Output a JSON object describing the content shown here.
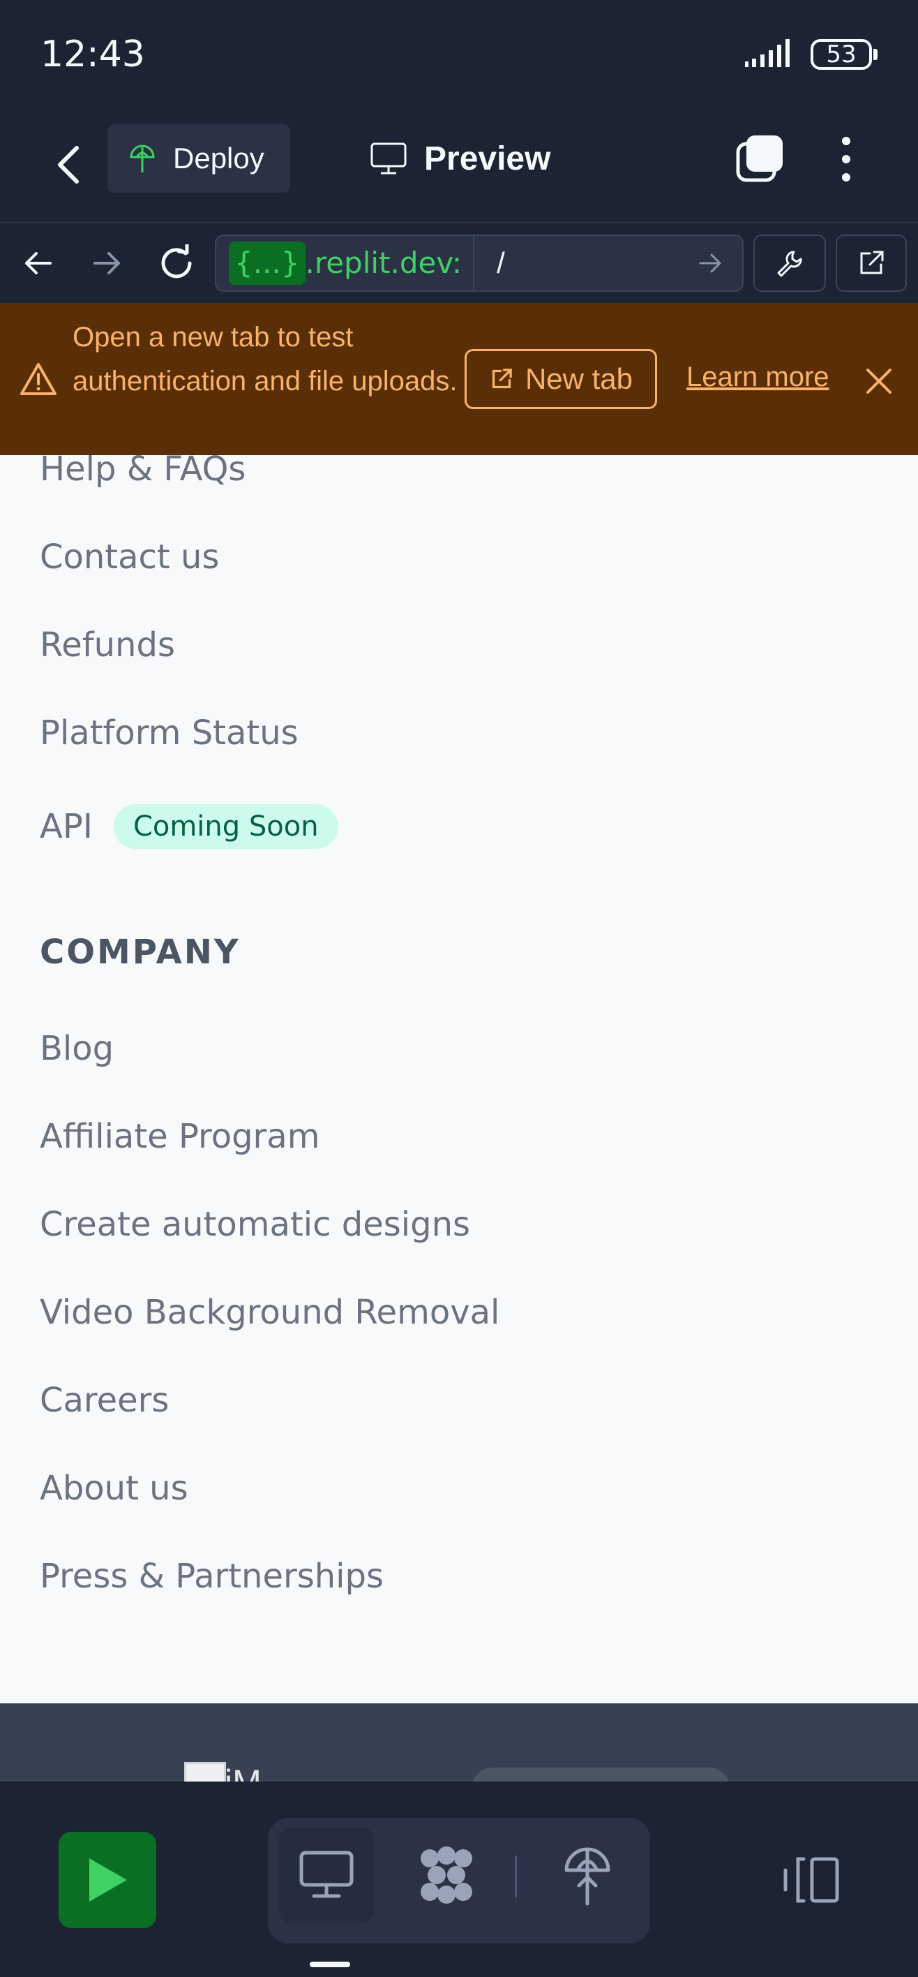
{
  "status_bar": {
    "time": "12:43",
    "battery": "53"
  },
  "top_bar": {
    "deploy_label": "Deploy",
    "preview_label": "Preview"
  },
  "url_bar": {
    "chip": "{...}",
    "host": ".replit.dev:",
    "path": "/"
  },
  "banner": {
    "message": "Open a new tab to test authentication and file uploads.",
    "new_tab_label": "New tab",
    "learn_more_label": "Learn more"
  },
  "content": {
    "support_links": [
      "Help & FAQs",
      "Contact us",
      "Refunds",
      "Platform Status"
    ],
    "api_label": "API",
    "api_badge": "Coming Soon",
    "company_title": "COMPANY",
    "company_links": [
      "Blog",
      "Affiliate Program",
      "Create automatic designs",
      "Video Background Removal",
      "Careers",
      "About us",
      "Press & Partnerships"
    ],
    "footer_logo_text": "iM"
  },
  "colors": {
    "accent_green": "#3fd163",
    "run_green": "#0a6e23",
    "banner_bg": "#5a2f07",
    "banner_text": "#f8b26c",
    "badge_bg": "#ccfbee"
  },
  "icons": {
    "back": "chevron-left-icon",
    "deploy": "deploy-icon",
    "preview": "monitor-icon",
    "tabs": "tabs-icon",
    "menu": "more-vertical-icon",
    "warning": "warning-icon",
    "external": "external-link-icon",
    "close": "close-icon",
    "run": "play-icon"
  }
}
